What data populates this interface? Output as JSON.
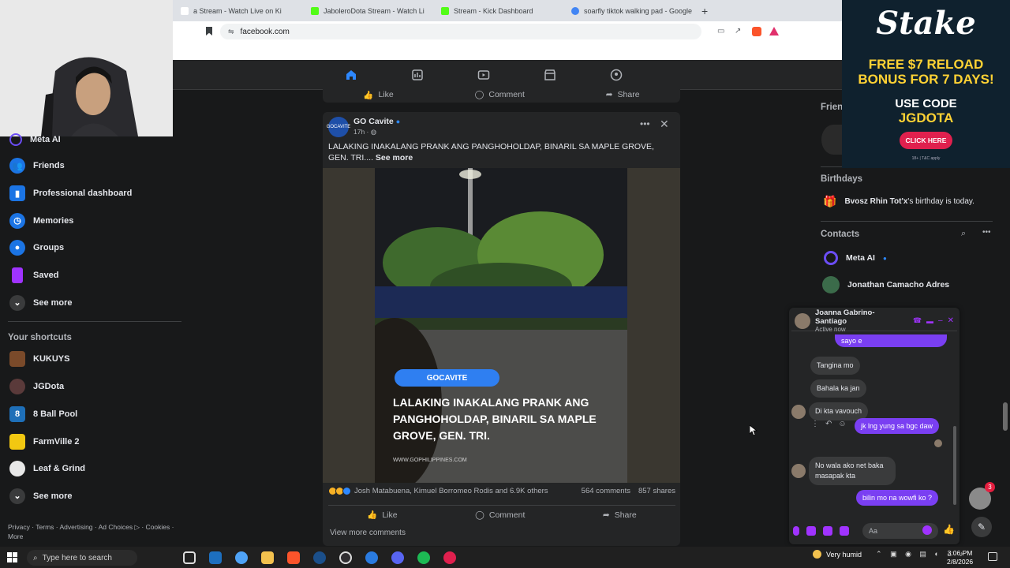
{
  "browser": {
    "tabs": [
      {
        "title": "a Stream - Watch Live on Ki",
        "color": "#53fc18"
      },
      {
        "title": "JaboleroDota Stream - Watch Li",
        "color": "#53fc18"
      },
      {
        "title": "Stream - Kick Dashboard",
        "color": "#53fc18"
      },
      {
        "title": "soarfly tiktok walking pad - Google S",
        "color": "#4285f4"
      }
    ],
    "new_tab": "+",
    "url": "facebook.com"
  },
  "left_nav": {
    "items": [
      {
        "label": "Meta AI",
        "icon": "meta-ai-icon",
        "color": "#6b4df5"
      },
      {
        "label": "Friends",
        "icon": "friends-icon",
        "color": "#1b74e4"
      },
      {
        "label": "Professional dashboard",
        "icon": "dashboard-icon",
        "color": "#1b74e4"
      },
      {
        "label": "Memories",
        "icon": "memories-icon",
        "color": "#1b74e4"
      },
      {
        "label": "Groups",
        "icon": "groups-icon",
        "color": "#1b74e4"
      },
      {
        "label": "Saved",
        "icon": "saved-icon",
        "color": "#a033ff"
      },
      {
        "label": "See more",
        "icon": "chevron-down-icon",
        "color": "#3a3b3c"
      }
    ],
    "shortcuts_title": "Your shortcuts",
    "shortcuts": [
      {
        "label": "KUKUYS",
        "color": "#7a4a2a"
      },
      {
        "label": "JGDota",
        "color": "#5a3a3a"
      },
      {
        "label": "8 Ball Pool",
        "color": "#1e6fb8"
      },
      {
        "label": "FarmVille 2",
        "color": "#f2c811"
      },
      {
        "label": "Leaf & Grind",
        "color": "#e8e8e8"
      },
      {
        "label": "See more",
        "color": "#3a3b3c"
      }
    ],
    "footer": "Privacy · Terms · Advertising · Ad Choices ▷ · Cookies · More"
  },
  "post": {
    "prev_actions": {
      "like": "Like",
      "comment": "Comment",
      "share": "Share"
    },
    "page_name": "GO Cavite",
    "time": "17h ·",
    "avatar_text": "GOCAVITE",
    "text": "LALAKING INAKALANG PRANK ANG PANGHOHOLDAP, BINARIL SA MAPLE GROVE, GEN. TRI....",
    "see_more": "See more",
    "video": {
      "pill": "GOCAVITE",
      "overlay": "LALAKING INAKALANG PRANK ANG PANGHOHOLDAP, BINARIL SA MAPLE GROVE, GEN. TRI.",
      "watermark": "WWW.GOPHILIPPINES.COM"
    },
    "reactions": "Josh Matabuena, Kimuel Borromeo Rodis and 6.9K others",
    "comments": "564 comments",
    "shares": "857 shares",
    "actions": {
      "like": "Like",
      "comment": "Comment",
      "share": "Share"
    },
    "view_comments": "View more comments"
  },
  "right": {
    "friends_partial": "Frien",
    "birthdays_title": "Birthdays",
    "birthday_name": "Bvosz Rhin Tot'x",
    "birthday_text": "'s birthday is today.",
    "contacts_title": "Contacts",
    "contacts": [
      {
        "name": "Meta AI",
        "color": "#6b4df5"
      },
      {
        "name": "Jonathan Camacho Adres",
        "color": "#3b6b4a"
      }
    ]
  },
  "ad": {
    "logo": "Stake",
    "line1": "FREE $7 RELOAD",
    "line2": "BONUS FOR 7 DAYS!",
    "code_label": "USE CODE",
    "code": "JGDOTA",
    "button": "CLICK HERE",
    "fine": "18+ | T&C apply"
  },
  "chat": {
    "name": "Joanna Gabrino-Santiago",
    "status": "Active now",
    "partial_out": "sayo e",
    "messages_in_1": [
      "Tangina mo",
      "Bahala ka jan",
      "Di kta vavouch"
    ],
    "out_1": "jk lng yung sa bgc daw",
    "in_2": "No wala ako net baka masapak kta",
    "out_2": "bilin mo na wowfi ko ?",
    "input_placeholder": "Aa",
    "badge": "3"
  },
  "taskbar": {
    "search_placeholder": "Type here to search",
    "weather": "Very humid",
    "time": "3:06 PM",
    "date": "2/8/2026"
  }
}
